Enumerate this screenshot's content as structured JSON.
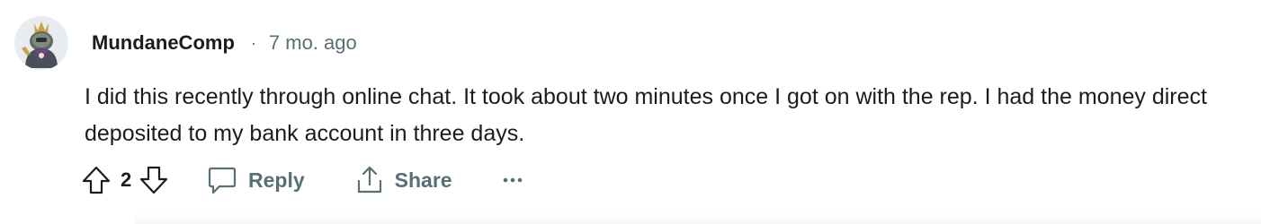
{
  "comment": {
    "username": "MundaneComp",
    "separator": "·",
    "timestamp": "7 mo. ago",
    "body": "I did this recently through online chat. It took about two minutes once I got on with the rep. I had the money direct deposited to my bank account in three days.",
    "score": "2"
  },
  "actions": {
    "reply_label": "Reply",
    "share_label": "Share",
    "more_label": "···"
  },
  "icons": {
    "upvote": "upvote-arrow-icon",
    "downvote": "downvote-arrow-icon",
    "reply": "speech-bubble-icon",
    "share": "share-upload-icon",
    "more": "ellipsis-icon"
  },
  "colors": {
    "text": "#1c1c1c",
    "muted": "#576f76",
    "background": "#ffffff"
  }
}
